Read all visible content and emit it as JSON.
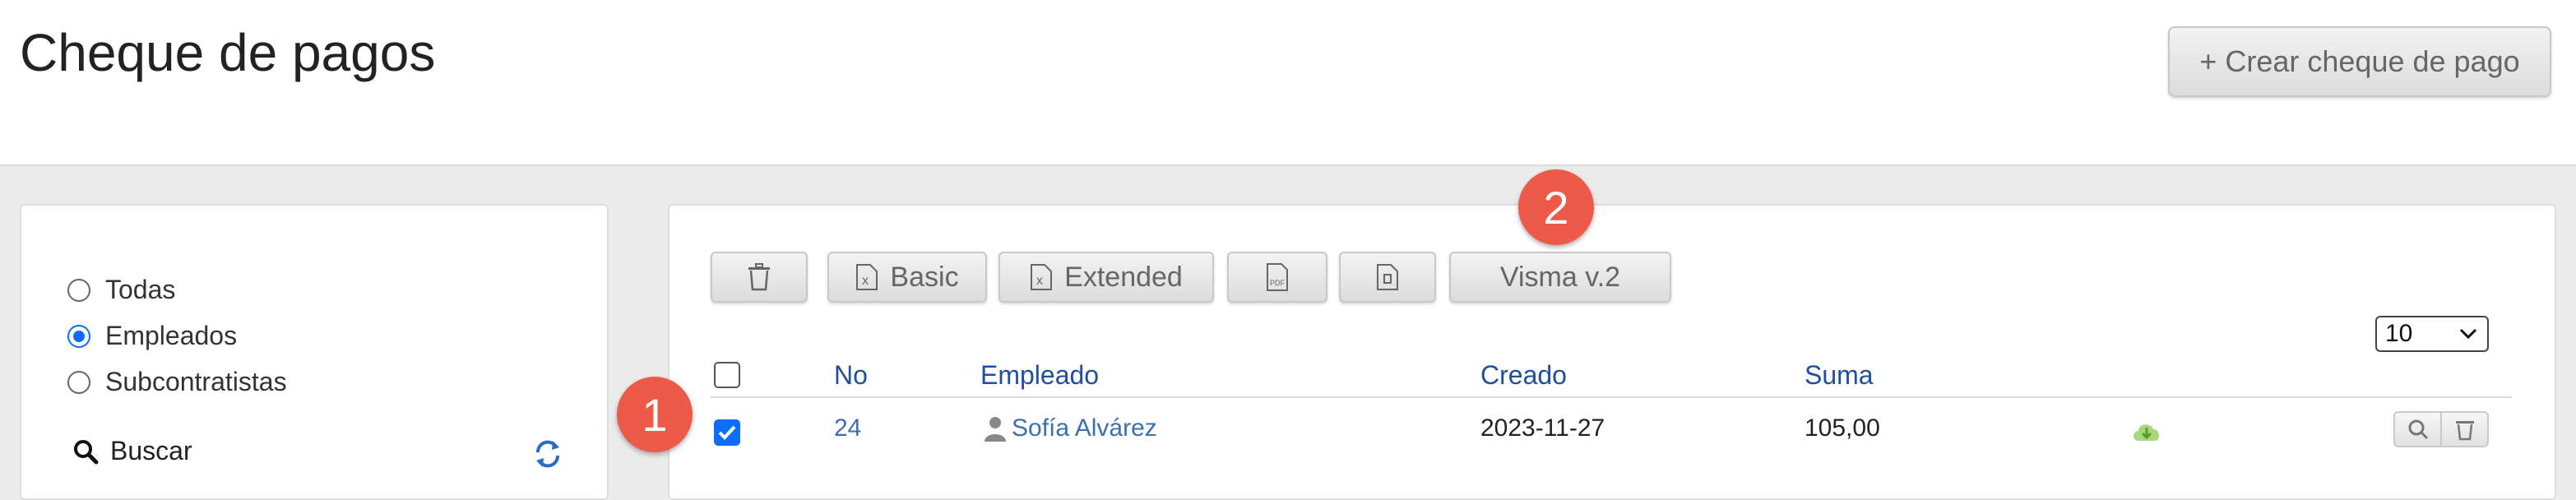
{
  "header": {
    "title": "Cheque de pagos",
    "create_label": "+ Crear cheque de pago"
  },
  "filter": {
    "options": [
      "Todas",
      "Empleados",
      "Subcontratistas"
    ],
    "selected": "Empleados",
    "search_label": "Buscar"
  },
  "toolbar": {
    "basic_label": "Basic",
    "extended_label": "Extended",
    "visma_label": "Visma v.2"
  },
  "annotations": {
    "one": "1",
    "two": "2"
  },
  "table": {
    "page_size": "10",
    "columns": [
      "No",
      "Empleado",
      "Creado",
      "Suma"
    ],
    "rows": [
      {
        "no": "24",
        "empleado": "Sofía Alvárez",
        "creado": "2023-11-27",
        "suma": "105,00",
        "selected": true
      }
    ]
  },
  "colors": {
    "accent": "#0d6efd",
    "link": "#1f4f9e",
    "badge": "#ee5a4a",
    "download": "#8bc34a"
  }
}
